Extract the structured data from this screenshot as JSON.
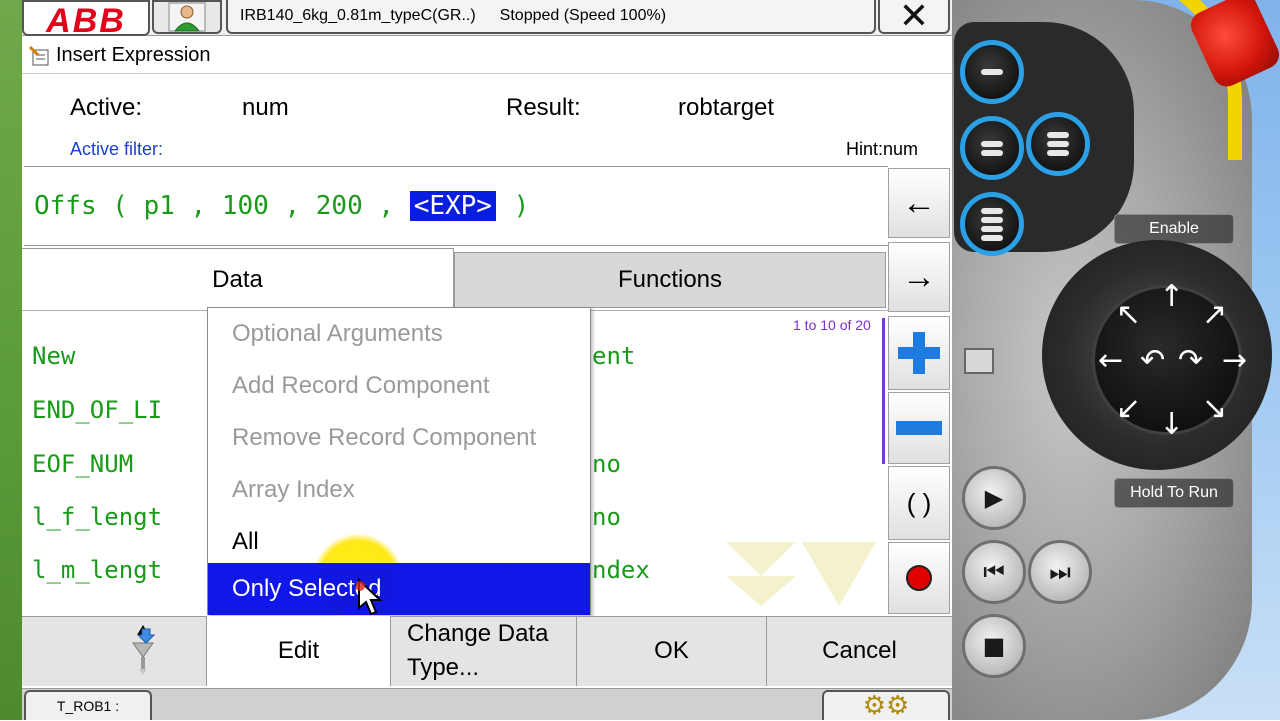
{
  "topbar": {
    "logo_text": "ABB",
    "robot_name": "IRB140_6kg_0.81m_typeC(GR..)",
    "status": "Stopped (Speed 100%)",
    "close_symbol": "✕"
  },
  "dialog": {
    "title": "Insert Expression",
    "active_label": "Active:",
    "active_value": "num",
    "result_label": "Result:",
    "result_value": "robtarget",
    "active_filter": "Active filter:",
    "hint": "Hint:num"
  },
  "expression": {
    "prefix": "Offs ( p1 , 100 , 200 , ",
    "placeholder": "<EXP>",
    "suffix": " )"
  },
  "side_buttons": {
    "left_arrow": "←",
    "right_arrow": "→",
    "plus": "+",
    "parens": "( )"
  },
  "tabs": [
    {
      "label": "Data"
    },
    {
      "label": "Functions"
    }
  ],
  "list": {
    "range": "1 to 10 of 20",
    "left_items": [
      "New",
      "END_OF_LI",
      "EOF_NUM",
      "l_f_lengt",
      "l_m_lengt"
    ],
    "right_items": [
      "ent",
      "",
      "no",
      "no",
      "ndex"
    ]
  },
  "popup_menu": {
    "items": [
      {
        "label": "Optional Arguments",
        "state": "disabled"
      },
      {
        "label": "Add Record Component",
        "state": "disabled"
      },
      {
        "label": "Remove Record Component",
        "state": "disabled"
      },
      {
        "label": "Array Index",
        "state": "disabled"
      },
      {
        "label": "All",
        "state": "enabled"
      },
      {
        "label": "Only Selected",
        "state": "selected"
      }
    ]
  },
  "bottom_bar": {
    "edit": "Edit",
    "change_line1": "Change Data",
    "change_line2": "Type...",
    "ok": "OK",
    "cancel": "Cancel"
  },
  "taskbar": {
    "task": "T_ROB1 :"
  },
  "hardware": {
    "enable_label": "Enable",
    "hold_to_run_label": "Hold To Run"
  },
  "colors": {
    "code_green": "#1a9a1a",
    "selection_blue": "#0a10e8",
    "filter_blue": "#1a3fd8",
    "key_ring_blue": "#2aa0e6",
    "estop_red": "#d0150a",
    "enabling_yellow": "#f2d400"
  }
}
